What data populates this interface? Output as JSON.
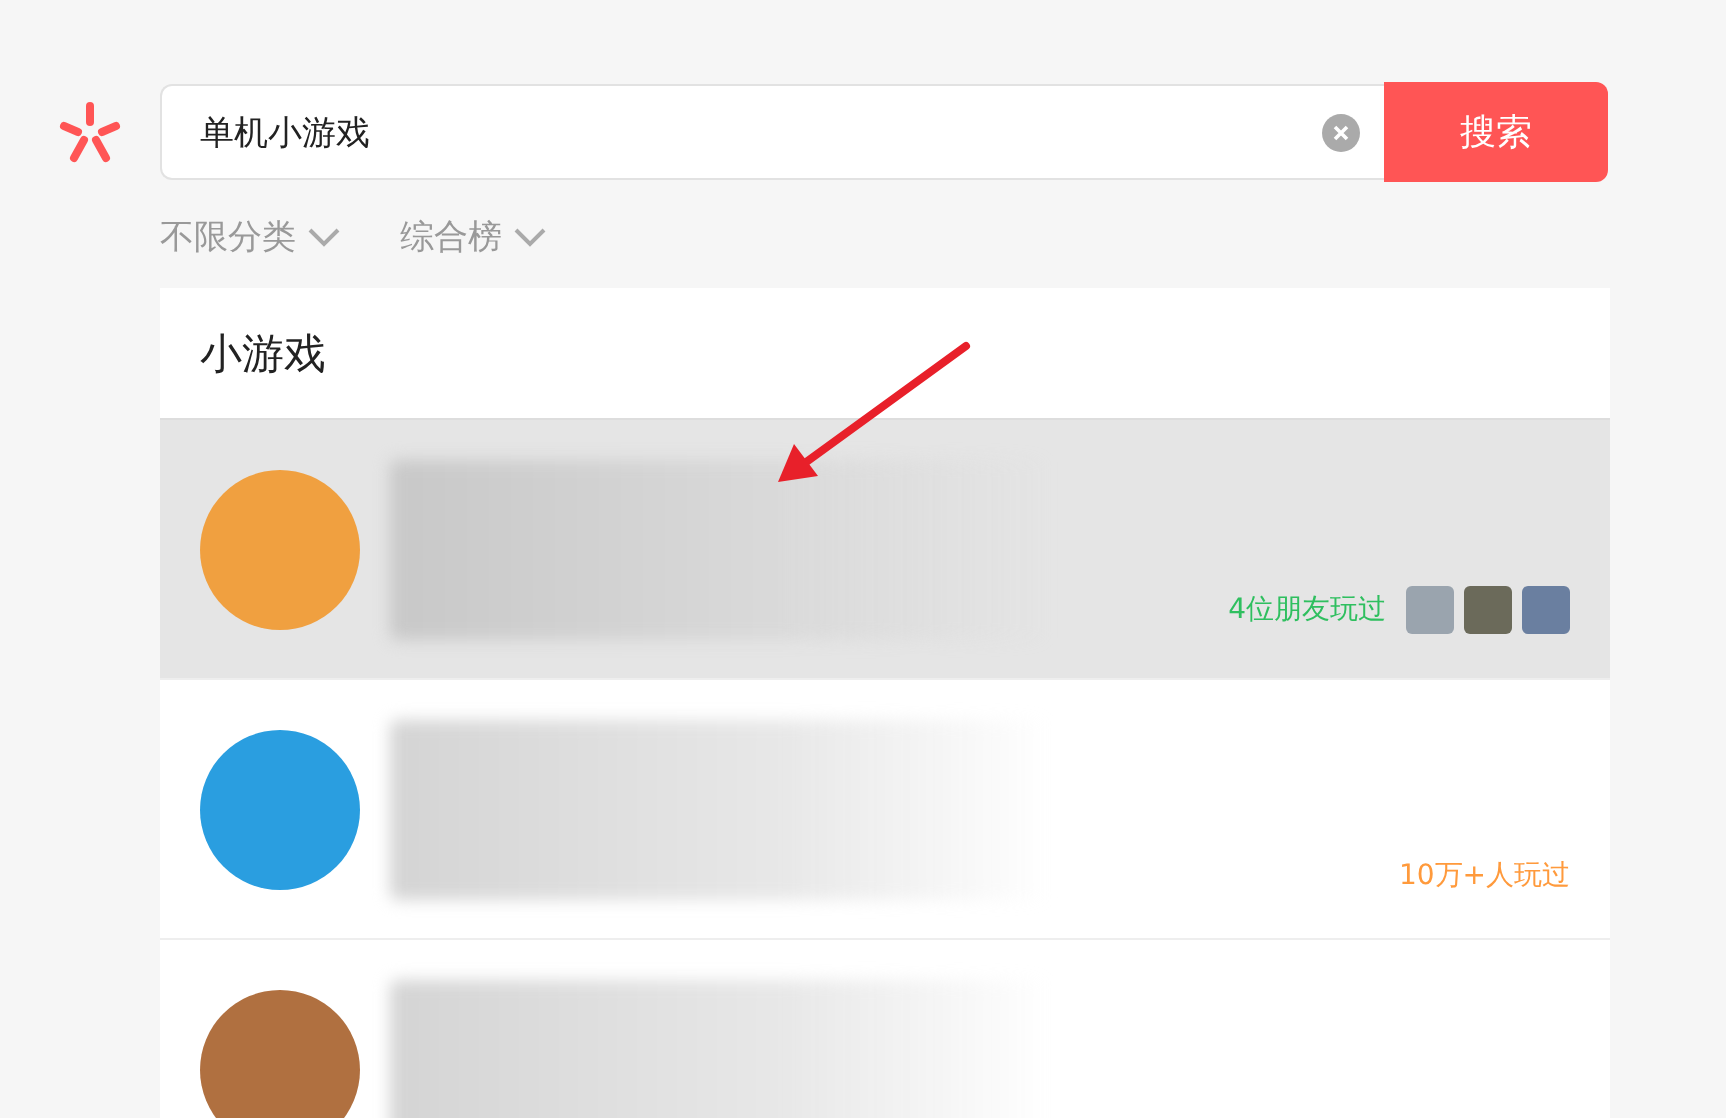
{
  "search": {
    "value": "单机小游戏",
    "button": "搜索"
  },
  "filters": [
    {
      "label": "不限分类"
    },
    {
      "label": "综合榜"
    }
  ],
  "section": {
    "title": "小游戏"
  },
  "games": [
    {
      "selected": true,
      "kind": "cartoon",
      "stats": {
        "kind": "friends",
        "text": "4位朋友玩过"
      }
    },
    {
      "selected": false,
      "kind": "billiards",
      "stats": {
        "kind": "players",
        "text": "10万+人玩过"
      }
    },
    {
      "selected": false,
      "kind": "character"
    }
  ]
}
